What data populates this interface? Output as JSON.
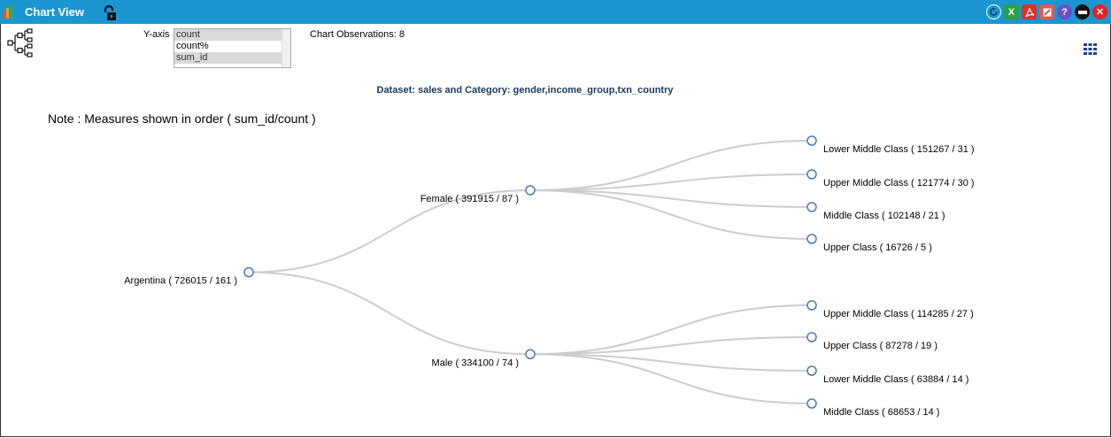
{
  "window": {
    "title": "Chart View",
    "accent": "#1b96d1",
    "toolbar_icons": [
      "refresh-icon",
      "excel-export-icon",
      "pdf-export-icon",
      "edit-icon",
      "help-icon",
      "minimize-icon",
      "close-icon"
    ]
  },
  "controls": {
    "yaxis_label": "Y-axis",
    "yaxis_options": [
      "count",
      "count%",
      "sum_id"
    ],
    "yaxis_selected": [
      "count",
      "sum_id"
    ],
    "observations": "Chart Observations: 8"
  },
  "dataset_title": "Dataset: sales and Category: gender,income_group,txn_country",
  "note": "Note : Measures shown in order ( sum_id/count )",
  "chart_data": {
    "type": "tree",
    "measures": [
      "sum_id",
      "count"
    ],
    "root": {
      "label": "Argentina ( 726015 / 161 )",
      "name": "Argentina",
      "sum_id": 726015,
      "count": 161,
      "children": [
        {
          "label": "Female ( 391915 / 87 )",
          "name": "Female",
          "sum_id": 391915,
          "count": 87,
          "children": [
            {
              "label": "Lower Middle Class ( 151267 / 31 )",
              "name": "Lower Middle Class",
              "sum_id": 151267,
              "count": 31
            },
            {
              "label": "Upper Middle Class ( 121774 / 30 )",
              "name": "Upper Middle Class",
              "sum_id": 121774,
              "count": 30
            },
            {
              "label": "Middle Class ( 102148 / 21 )",
              "name": "Middle Class",
              "sum_id": 102148,
              "count": 21
            },
            {
              "label": "Upper Class ( 16726 / 5 )",
              "name": "Upper Class",
              "sum_id": 16726,
              "count": 5
            }
          ]
        },
        {
          "label": "Male ( 334100 / 74 )",
          "name": "Male",
          "sum_id": 334100,
          "count": 74,
          "children": [
            {
              "label": "Upper Middle Class ( 114285 / 27 )",
              "name": "Upper Middle Class",
              "sum_id": 114285,
              "count": 27
            },
            {
              "label": "Upper Class ( 87278 / 19 )",
              "name": "Upper Class",
              "sum_id": 87278,
              "count": 19
            },
            {
              "label": "Lower Middle Class ( 63884 / 14 )",
              "name": "Lower Middle Class",
              "sum_id": 63884,
              "count": 14
            },
            {
              "label": "Middle Class ( 68653 / 14 )",
              "name": "Middle Class",
              "sum_id": 68653,
              "count": 14
            }
          ]
        }
      ]
    },
    "link_color": "#cccccc",
    "node_stroke": "#4a7ab8"
  }
}
